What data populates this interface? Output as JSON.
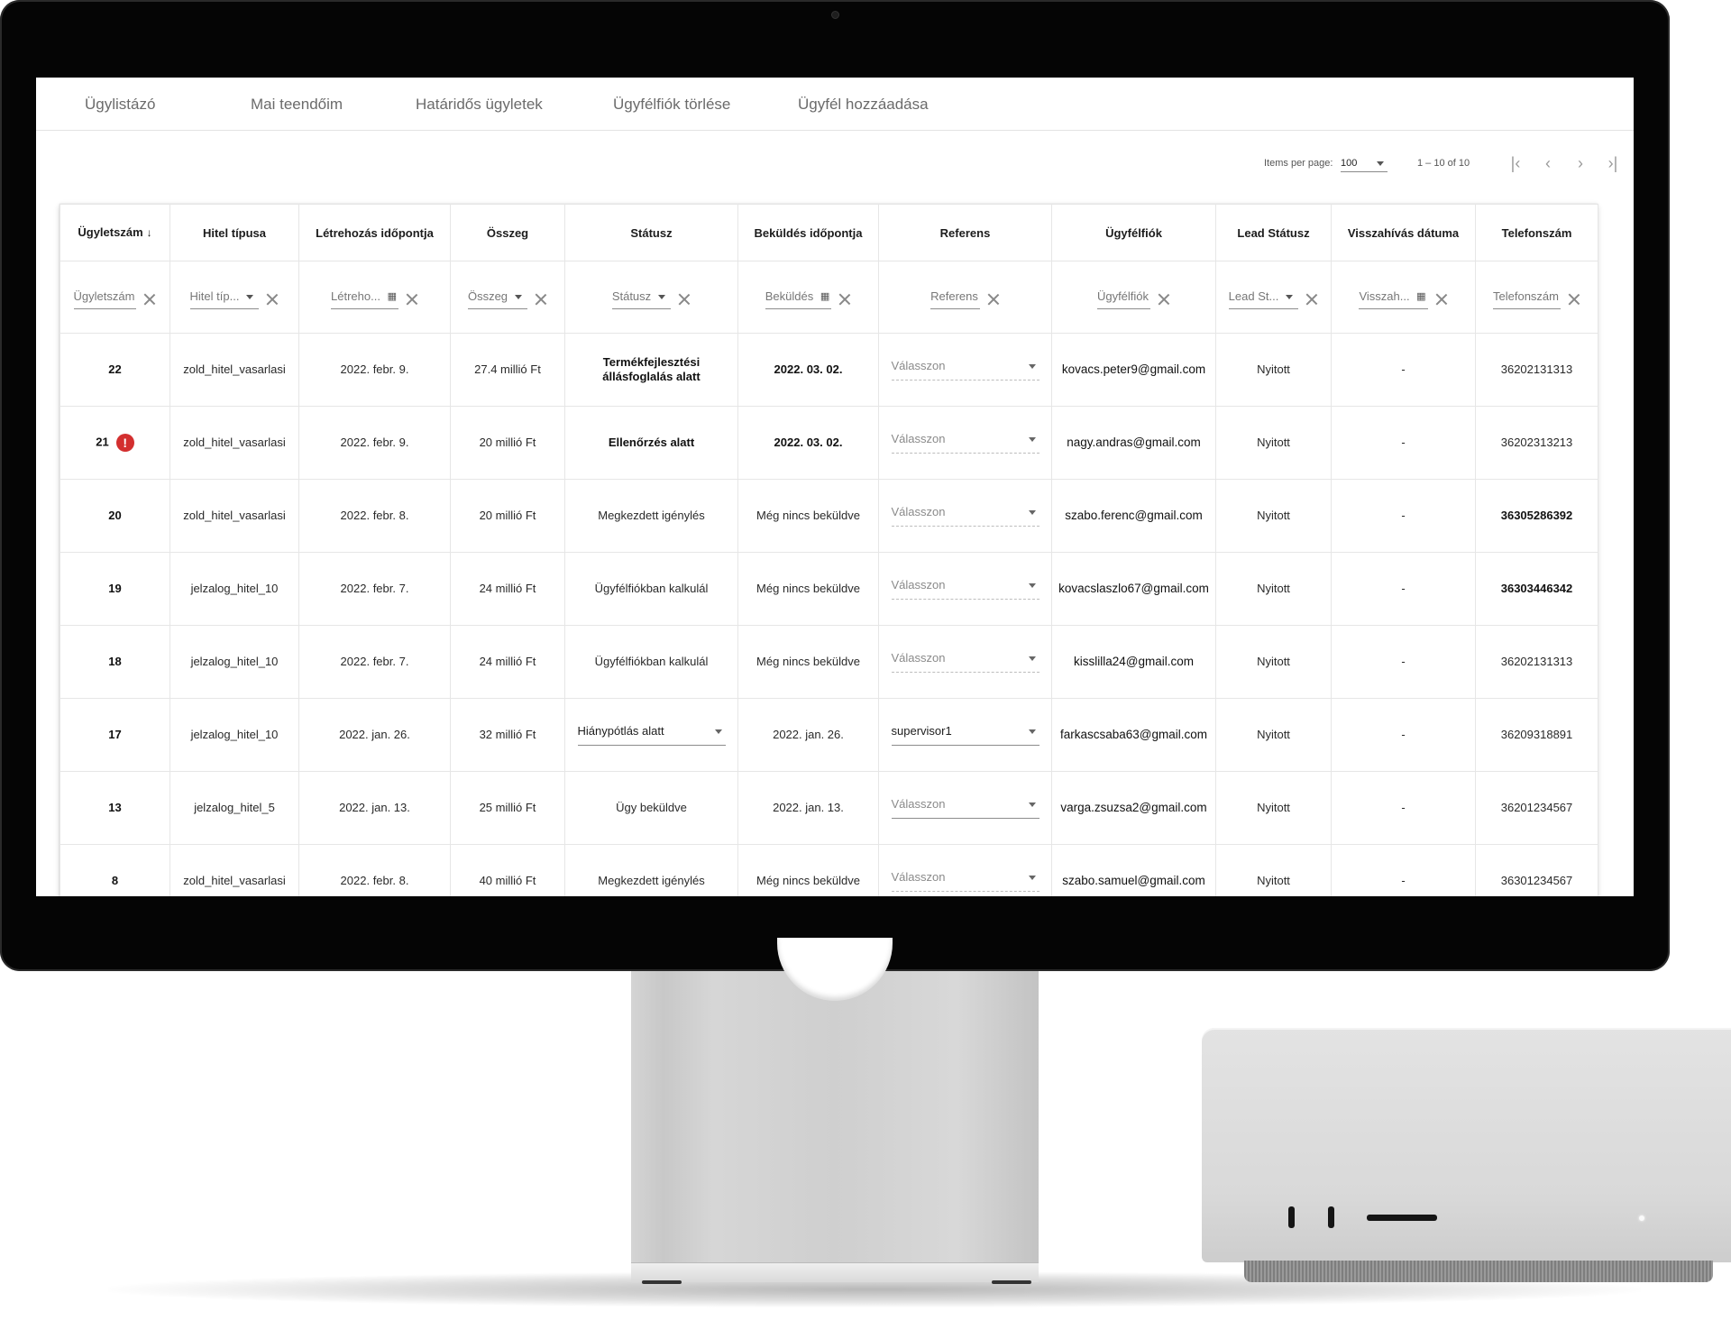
{
  "nav": {
    "tabs": [
      "Ügylistázó",
      "Mai teendőim",
      "Határidős ügyletek",
      "Ügyfélfiók törlése",
      "Ügyfél hozzáadása"
    ]
  },
  "paginator": {
    "items_per_page_label": "Items per page:",
    "items_per_page_value": "100",
    "range_label": "1 – 10 of 10",
    "first_icon": "first-page-icon",
    "prev_icon": "chevron-left-icon",
    "next_icon": "chevron-right-icon",
    "last_icon": "last-page-icon"
  },
  "table": {
    "headers": [
      "Ügyletszám",
      "Hitel típusa",
      "Létrehozás időpontja",
      "Összeg",
      "Státusz",
      "Beküldés időpontja",
      "Referens",
      "Ügyfélfiók",
      "Lead Státusz",
      "Visszahívás dátuma",
      "Telefonszám"
    ],
    "sort_icon": "arrow-down-icon",
    "filters": [
      {
        "placeholder": "Ügyletszám",
        "kind": "text"
      },
      {
        "placeholder": "Hitel típ...",
        "kind": "select"
      },
      {
        "placeholder": "Létreho...",
        "kind": "date"
      },
      {
        "placeholder": "Összeg",
        "kind": "select"
      },
      {
        "placeholder": "Státusz",
        "kind": "select"
      },
      {
        "placeholder": "Beküldés",
        "kind": "date"
      },
      {
        "placeholder": "Referens",
        "kind": "text"
      },
      {
        "placeholder": "Ügyfélfiók",
        "kind": "text"
      },
      {
        "placeholder": "Lead St...",
        "kind": "select"
      },
      {
        "placeholder": "Visszah...",
        "kind": "date"
      },
      {
        "placeholder": "Telefonszám",
        "kind": "text"
      }
    ],
    "rows": [
      {
        "id": "22",
        "alert": false,
        "loan_type": "zold_hitel_vasarlasi",
        "created": "2022. febr. 9.",
        "amount": "27.4 millió Ft",
        "status": "Termékfejlesztési állásfoglalás alatt",
        "status_bold": true,
        "status_select": false,
        "sent": "2022. 03. 02.",
        "sent_bold": true,
        "referent": "Válasszon",
        "referent_filled": false,
        "email": "kovacs.peter9@gmail.com",
        "lead_status": "Nyitott",
        "callback": "-",
        "phone": "36202131313",
        "phone_bold": false
      },
      {
        "id": "21",
        "alert": true,
        "loan_type": "zold_hitel_vasarlasi",
        "created": "2022. febr. 9.",
        "amount": "20 millió Ft",
        "status": "Ellenőrzés alatt",
        "status_bold": true,
        "status_select": false,
        "sent": "2022. 03. 02.",
        "sent_bold": true,
        "referent": "Válasszon",
        "referent_filled": false,
        "email": "nagy.andras@gmail.com",
        "lead_status": "Nyitott",
        "callback": "-",
        "phone": "36202313213",
        "phone_bold": false
      },
      {
        "id": "20",
        "alert": false,
        "loan_type": "zold_hitel_vasarlasi",
        "created": "2022. febr. 8.",
        "amount": "20 millió Ft",
        "status": "Megkezdett igénylés",
        "status_bold": false,
        "status_select": false,
        "sent": "Még nincs beküldve",
        "sent_bold": false,
        "referent": "Válasszon",
        "referent_filled": false,
        "email": "szabo.ferenc@gmail.com",
        "lead_status": "Nyitott",
        "callback": "-",
        "phone": "36305286392",
        "phone_bold": true
      },
      {
        "id": "19",
        "alert": false,
        "loan_type": "jelzalog_hitel_10",
        "created": "2022. febr. 7.",
        "amount": "24 millió Ft",
        "status": "Ügyfélfiókban kalkulál",
        "status_bold": false,
        "status_select": false,
        "sent": "Még nincs beküldve",
        "sent_bold": false,
        "referent": "Válasszon",
        "referent_filled": false,
        "email": "kovacslaszlo67@gmail.com",
        "lead_status": "Nyitott",
        "callback": "-",
        "phone": "36303446342",
        "phone_bold": true
      },
      {
        "id": "18",
        "alert": false,
        "loan_type": "jelzalog_hitel_10",
        "created": "2022. febr. 7.",
        "amount": "24 millió Ft",
        "status": "Ügyfélfiókban kalkulál",
        "status_bold": false,
        "status_select": false,
        "sent": "Még nincs beküldve",
        "sent_bold": false,
        "referent": "Válasszon",
        "referent_filled": false,
        "email": "kisslilla24@gmail.com",
        "lead_status": "Nyitott",
        "callback": "-",
        "phone": "36202131313",
        "phone_bold": false
      },
      {
        "id": "17",
        "alert": false,
        "loan_type": "jelzalog_hitel_10",
        "created": "2022. jan. 26.",
        "amount": "32 millió Ft",
        "status": "Hiánypótlás alatt",
        "status_bold": false,
        "status_select": true,
        "sent": "2022. jan. 26.",
        "sent_bold": false,
        "referent": "supervisor1",
        "referent_filled": true,
        "email": "farkascsaba63@gmail.com",
        "lead_status": "Nyitott",
        "callback": "-",
        "phone": "36209318891",
        "phone_bold": false
      },
      {
        "id": "13",
        "alert": false,
        "loan_type": "jelzalog_hitel_5",
        "created": "2022. jan. 13.",
        "amount": "25 millió Ft",
        "status": "Ügy beküldve",
        "status_bold": false,
        "status_select": false,
        "sent": "2022. jan. 13.",
        "sent_bold": false,
        "referent": "Válasszon",
        "referent_filled": true,
        "email": "varga.zsuzsa2@gmail.com",
        "lead_status": "Nyitott",
        "callback": "-",
        "phone": "36201234567",
        "phone_bold": false
      },
      {
        "id": "8",
        "alert": false,
        "loan_type": "zold_hitel_vasarlasi",
        "created": "2022. febr. 8.",
        "amount": "40 millió Ft",
        "status": "Megkezdett igénylés",
        "status_bold": false,
        "status_select": false,
        "sent": "Még nincs beküldve",
        "sent_bold": false,
        "referent": "Válasszon",
        "referent_filled": false,
        "email": "szabo.samuel@gmail.com",
        "lead_status": "Nyitott",
        "callback": "-",
        "phone": "36301234567",
        "phone_bold": false
      }
    ]
  },
  "icons": {
    "alert": "exclamation-icon",
    "calendar": "calendar-icon",
    "clear": "close-icon",
    "dropdown": "chevron-down-icon"
  },
  "colors": {
    "alert": "#d32f2f",
    "nav_text": "#6b6b6b",
    "border": "#e6e6e6"
  }
}
